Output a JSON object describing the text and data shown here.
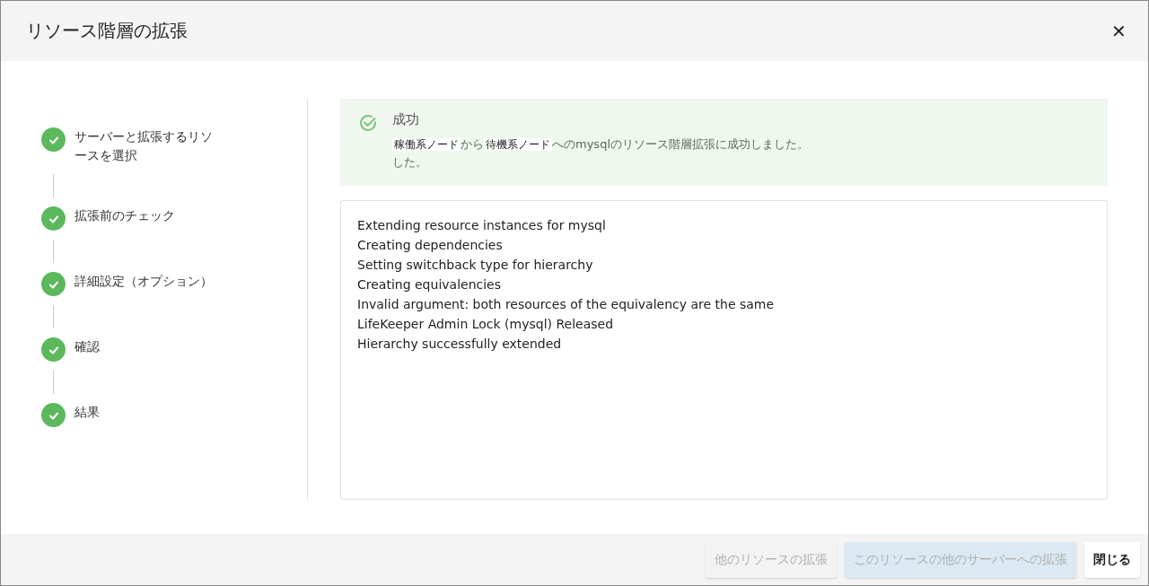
{
  "dialog": {
    "title": "リソース階層の拡張",
    "close": "✕"
  },
  "steps": [
    {
      "label": "サーバーと拡張するリソースを選択",
      "done": true
    },
    {
      "label": "拡張前のチェック",
      "done": true
    },
    {
      "label": "詳細設定（オプション）",
      "done": true
    },
    {
      "label": "確認",
      "done": true
    },
    {
      "label": "結果",
      "done": true
    }
  ],
  "alert": {
    "title": "成功",
    "message": [
      {
        "kind": "node",
        "text": "稼働系ノード"
      },
      {
        "kind": "text",
        "text": "から"
      },
      {
        "kind": "node",
        "text": "待機系ノード"
      },
      {
        "kind": "text",
        "text": "へのmysqlのリソース階層拡張に成功しました。"
      }
    ],
    "extra_line": "した。"
  },
  "log": [
    "Extending resource instances for mysql",
    "Creating dependencies",
    "Setting switchback type for hierarchy",
    "Creating equivalencies",
    "Invalid argument: both resources of the equivalency are the same",
    "LifeKeeper Admin Lock (mysql) Released",
    "Hierarchy successfully extended"
  ],
  "buttons": [
    {
      "label": "他のリソースの拡張",
      "kind": "secondary",
      "disabled": true
    },
    {
      "label": "このリソースの他のサーバーへの拡張",
      "kind": "primary",
      "disabled": true
    },
    {
      "label": "閉じる",
      "kind": "secondary",
      "disabled": false
    }
  ]
}
